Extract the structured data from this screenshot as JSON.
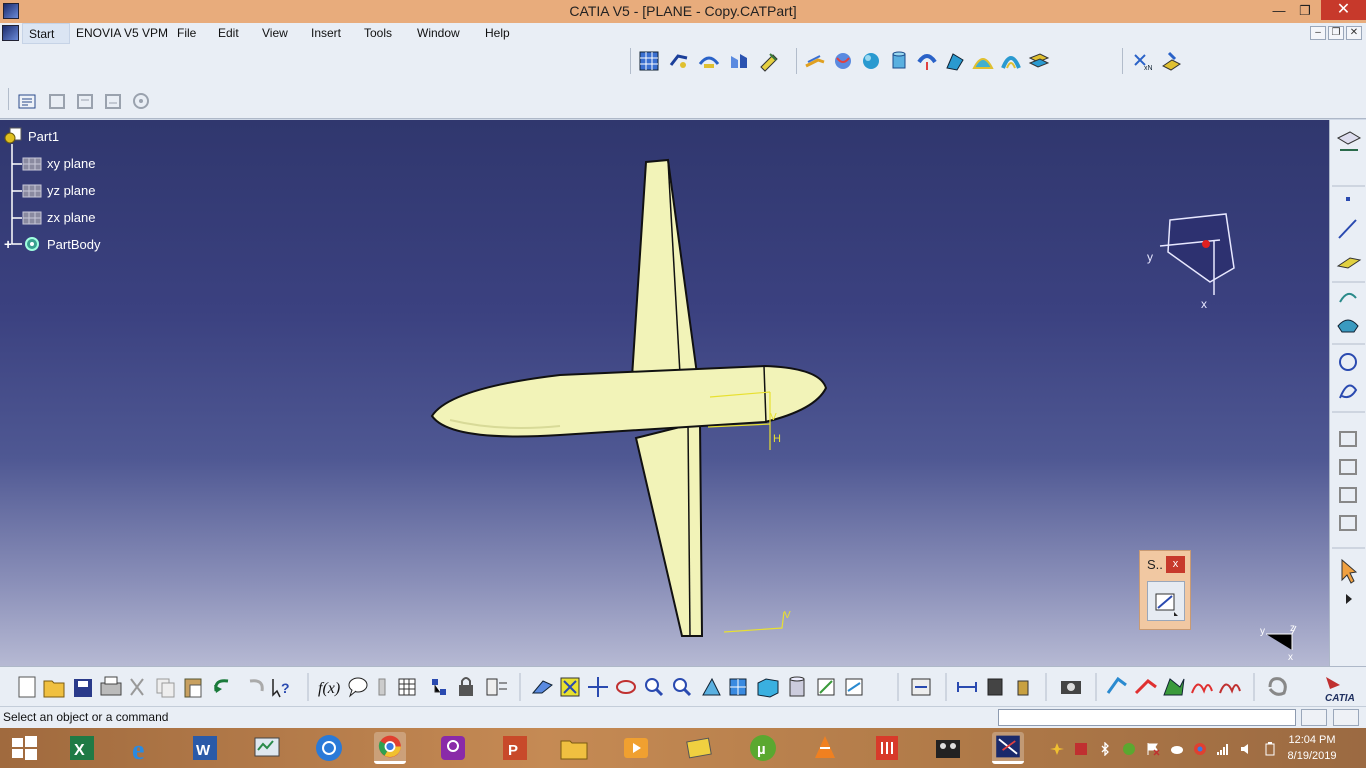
{
  "window": {
    "title": "CATIA V5 - [PLANE - Copy.CATPart]",
    "minimize_glyph": "—",
    "restore_glyph": "❐",
    "close_glyph": "✕"
  },
  "menu": {
    "items": [
      "Start",
      "ENOVIA V5 VPM",
      "File",
      "Edit",
      "View",
      "Insert",
      "Tools",
      "Window",
      "Help"
    ],
    "doc_minimize": "–",
    "doc_restore": "❐",
    "doc_close": "✕"
  },
  "tree": {
    "root": "Part1",
    "children": [
      "xy plane",
      "yz plane",
      "zx plane",
      "PartBody"
    ]
  },
  "compass": {
    "axis_y": "y",
    "axis_x": "x"
  },
  "viewport_marks": {
    "h_label": "H",
    "v_label": "V"
  },
  "triad": {
    "y": "y",
    "z": "z",
    "x": "x"
  },
  "sketch_window": {
    "label": "S..",
    "close": "x"
  },
  "statusbar": {
    "message": "Select an object or a command",
    "command_value": ""
  },
  "taskbar": {
    "time": "12:04 PM",
    "date": "8/19/2019"
  },
  "colors": {
    "viewport_top": "#30376e",
    "viewport_bottom": "#b6b9d3",
    "part_fill": "#f2f3b8",
    "titlebar": "#e8ac7c",
    "close_red": "#c7392b"
  },
  "icons": {
    "top_toolbar": [
      "surface-icon",
      "extrude-icon",
      "sweep-icon",
      "fill-icon",
      "multi-section-icon",
      "offset-icon",
      "blend-icon",
      "sphere-icon",
      "cylinder-icon",
      "revolve-icon",
      "loft-icon",
      "dome-icon",
      "shell-icon",
      "layer-icon",
      "join-icon",
      "boolean-icon"
    ],
    "left_toolbar": [
      "properties-icon",
      "repeat-icon",
      "reorder-icon",
      "isolate-icon",
      "pattern-icon"
    ],
    "right_toolbar": [
      "sketch-plane-icon",
      "point-icon",
      "line-icon",
      "plane-icon",
      "spline-icon",
      "surface-patch-icon",
      "circle-icon",
      "curve-icon",
      "feature1-icon",
      "feature2-icon",
      "feature3-icon",
      "feature4-icon",
      "select-arrow-icon",
      "more-icon"
    ],
    "bottom_toolbar": [
      "new-icon",
      "open-icon",
      "save-icon",
      "print-icon",
      "cut-icon",
      "copy-icon",
      "paste-icon",
      "undo-icon",
      "redo-icon",
      "whats-this-icon",
      "formula-icon",
      "comment-icon",
      "measure-icon",
      "table-icon",
      "tree-icon",
      "lock-icon",
      "param-icon",
      "fly-icon",
      "fit-all-icon",
      "pan-icon",
      "rotate-icon",
      "zoom-in-icon",
      "zoom-out-icon",
      "normal-view-icon",
      "multi-view-icon",
      "iso-view-icon",
      "render-icon",
      "hide-icon",
      "swap-icon",
      "analyze-icon",
      "distance-icon",
      "inertia-icon",
      "capture-icon",
      "draft-analysis-icon",
      "curvature-icon",
      "map-icon",
      "wave-icon",
      "update-icon",
      "catia-logo-icon"
    ]
  }
}
